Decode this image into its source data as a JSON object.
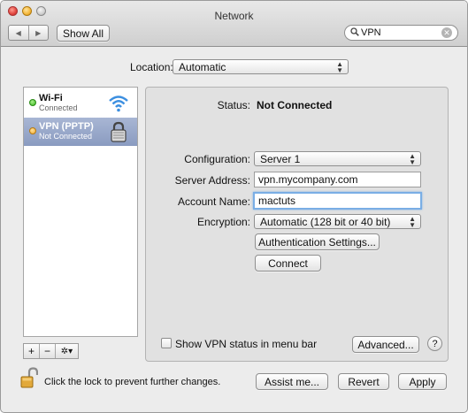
{
  "window": {
    "title": "Network"
  },
  "toolbar": {
    "back_glyph": "◀",
    "forward_glyph": "▶",
    "show_all_label": "Show All",
    "search_value": "VPN",
    "search_icon": "search-icon"
  },
  "location": {
    "label": "Location:",
    "value": "Automatic"
  },
  "services": [
    {
      "name": "Wi-Fi",
      "status": "Connected",
      "status_color": "#35b41c",
      "icon": "wifi-icon"
    },
    {
      "name": "VPN (PPTP)",
      "status": "Not Connected",
      "status_color": "#f0a92c",
      "icon": "lock-vpn-icon",
      "selected": true
    }
  ],
  "sidebar_tools": {
    "add": "+",
    "remove": "−",
    "action": "✲▾"
  },
  "detail": {
    "status_label": "Status:",
    "status_value": "Not Connected",
    "configuration_label": "Configuration:",
    "configuration_value": "Server 1",
    "server_address_label": "Server Address:",
    "server_address_value": "vpn.mycompany.com",
    "account_name_label": "Account Name:",
    "account_name_value": "mactuts",
    "encryption_label": "Encryption:",
    "encryption_value": "Automatic (128 bit or 40 bit)",
    "auth_settings_label": "Authentication Settings...",
    "connect_label": "Connect",
    "show_status_label": "Show VPN status in menu bar",
    "advanced_label": "Advanced...",
    "help_label": "?"
  },
  "footer": {
    "lock_text": "Click the lock to prevent further changes.",
    "assist_label": "Assist me...",
    "revert_label": "Revert",
    "apply_label": "Apply"
  },
  "colors": {
    "selection": "#8a9bc0",
    "focus_ring": "#7aaee5"
  }
}
